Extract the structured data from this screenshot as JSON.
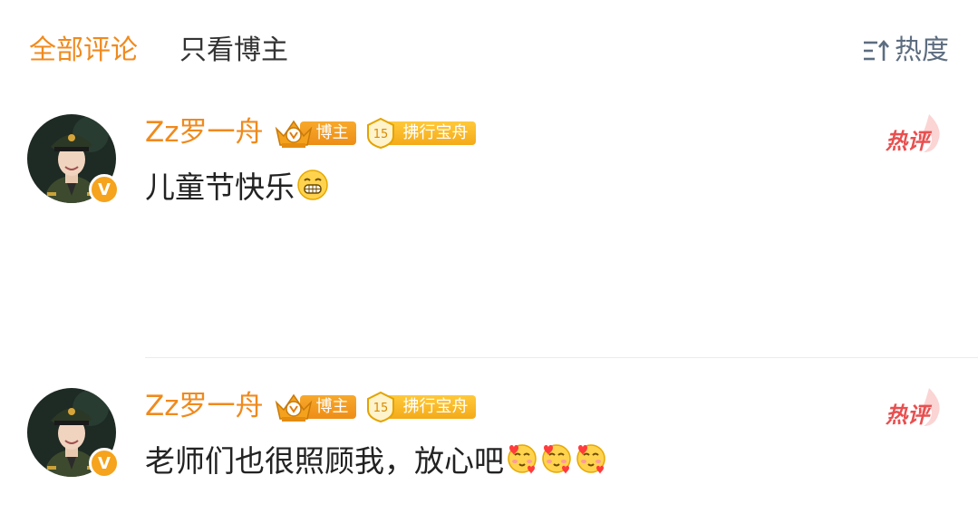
{
  "tabs": {
    "all_comments": "全部评论",
    "owner_only": "只看博主"
  },
  "sort": {
    "label": "热度",
    "icon": "sort-icon"
  },
  "comments": [
    {
      "user": {
        "name": "Zz罗一舟",
        "verified": "V"
      },
      "badges": {
        "owner": "博主",
        "rank_level": "15",
        "rank_label": "拂行宝舟"
      },
      "hot_label": "热评",
      "text": "儿童节快乐",
      "emojis": [
        "grin-emoji"
      ]
    },
    {
      "user": {
        "name": "Zz罗一舟",
        "verified": "V"
      },
      "badges": {
        "owner": "博主",
        "rank_level": "15",
        "rank_label": "拂行宝舟"
      },
      "hot_label": "热评",
      "text": "老师们也很照顾我，放心吧",
      "emojis": [
        "heart-face-emoji",
        "heart-face-emoji",
        "heart-face-emoji"
      ]
    }
  ],
  "colors": {
    "accent": "#f08a1d",
    "hot": "#e94f4f",
    "sort": "#5d6d80"
  }
}
